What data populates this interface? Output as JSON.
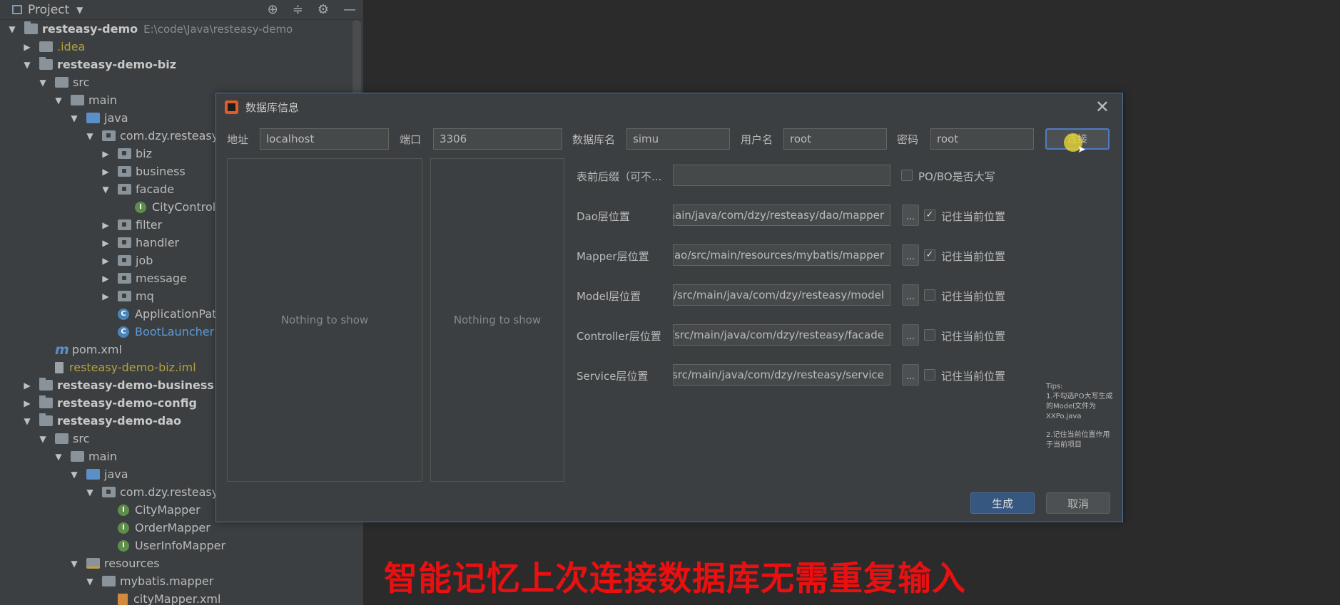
{
  "panel": {
    "title": "Project",
    "dropdown_icon": "triangle-down",
    "tools": [
      "crosshair-icon",
      "collapse-icon",
      "gear-icon",
      "minimize-icon"
    ]
  },
  "tree": [
    {
      "label": "resteasy-demo",
      "path": "E:\\code\\Java\\resteasy-demo"
    },
    {
      "label": ".idea"
    },
    {
      "label": "resteasy-demo-biz"
    },
    {
      "label": "src"
    },
    {
      "label": "main"
    },
    {
      "label": "java"
    },
    {
      "label": "com.dzy.resteasy"
    },
    {
      "label": "biz"
    },
    {
      "label": "business"
    },
    {
      "label": "facade"
    },
    {
      "label": "CityControlle"
    },
    {
      "label": "filter"
    },
    {
      "label": "handler"
    },
    {
      "label": "job"
    },
    {
      "label": "message"
    },
    {
      "label": "mq"
    },
    {
      "label": "ApplicationPath"
    },
    {
      "label": "BootLauncher"
    },
    {
      "label": "pom.xml"
    },
    {
      "label": "resteasy-demo-biz.iml"
    },
    {
      "label": "resteasy-demo-business"
    },
    {
      "label": "resteasy-demo-config"
    },
    {
      "label": "resteasy-demo-dao"
    },
    {
      "label": "src"
    },
    {
      "label": "main"
    },
    {
      "label": "java"
    },
    {
      "label": "com.dzy.resteasy.d"
    },
    {
      "label": "CityMapper"
    },
    {
      "label": "OrderMapper"
    },
    {
      "label": "UserInfoMapper"
    },
    {
      "label": "resources"
    },
    {
      "label": "mybatis.mapper"
    },
    {
      "label": "cityMapper.xml"
    }
  ],
  "dialog": {
    "title": "数据库信息",
    "close": "✕",
    "connection": {
      "address_label": "地址",
      "address_value": "localhost",
      "port_label": "端口",
      "port_value": "3306",
      "db_label": "数据库名",
      "db_value": "simu",
      "user_label": "用户名",
      "user_value": "root",
      "password_label": "密码",
      "password_value": "root",
      "connect_button": "连接"
    },
    "lists": {
      "left_empty": "Nothing to show",
      "right_empty": "Nothing to show"
    },
    "prefix": {
      "label": "表前后缀（可不...",
      "value": "",
      "uppercase_label": "PO/BO是否大写",
      "uppercase_checked": false
    },
    "layers": [
      {
        "label": "Dao层位置",
        "value": "aain/java/com/dzy/resteasy/dao/mapper",
        "remember_label": "记住当前位置",
        "checked": true
      },
      {
        "label": "Mapper层位置",
        "value": "ao/src/main/resources/mybatis/mapper",
        "remember_label": "记住当前位置",
        "checked": true
      },
      {
        "label": "Model层位置",
        "value": "/src/main/java/com/dzy/resteasy/model",
        "remember_label": "记住当前位置",
        "checked": false
      },
      {
        "label": "Controller层位置",
        "value": "/src/main/java/com/dzy/resteasy/facade",
        "remember_label": "记住当前位置",
        "checked": false
      },
      {
        "label": "Service层位置",
        "value": "src/main/java/com/dzy/resteasy/service",
        "remember_label": "记住当前位置",
        "checked": false
      }
    ],
    "browse_label": "...",
    "tips": {
      "title": "Tips:",
      "line1": "1.不勾选PO大写生成的Model文件为XXPo.java",
      "line2": "2.记住当前位置作用于当前项目"
    },
    "generate_button": "生成",
    "cancel_button": "取消"
  },
  "caption": "智能记忆上次连接数据库无需重复输入"
}
